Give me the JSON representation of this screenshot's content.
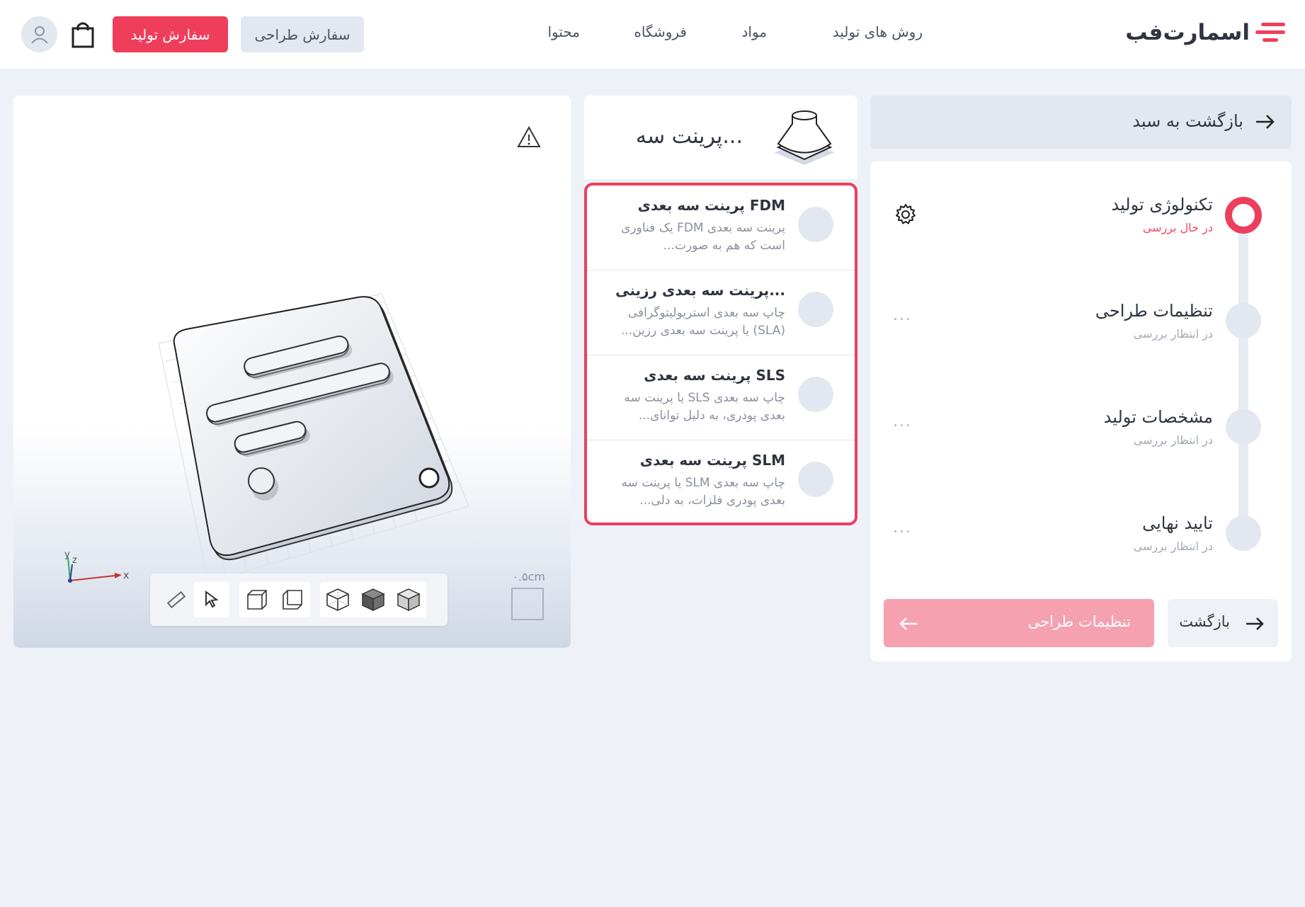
{
  "header": {
    "logo_text": "اسمارت‌فب",
    "nav": [
      {
        "label": "روش های تولید"
      },
      {
        "label": "مواد"
      },
      {
        "label": "فروشگاه"
      },
      {
        "label": "محتوا"
      }
    ],
    "design_order_label": "سفارش طراحی",
    "production_order_label": "سفارش تولید"
  },
  "viewer": {
    "scale_label": "۰.۵cm",
    "axis_x": "x",
    "axis_y": "y",
    "axis_z": "z"
  },
  "technology": {
    "header_title": "پرینت سه...",
    "items": [
      {
        "title": "پرینت سه بعدی FDM",
        "desc": "پرینت سه بعدی FDM یک فناوری است که هم به صورت..."
      },
      {
        "title": "پرینت سه بعدی رزینی...",
        "desc": "چاپ سه بعدی استریولیتوگرافی (SLA) یا پرینت سه بعدی رزین..."
      },
      {
        "title": "پرینت سه بعدی SLS",
        "desc": "چاپ سه بعدی SLS یا پرینت سه بعدی پودری، به دلیل توانای..."
      },
      {
        "title": "پرینت سه بعدی SLM",
        "desc": "چاپ سه بعدی SLM یا پرینت سه بعدی پودری فلزات، به دلی..."
      }
    ]
  },
  "steps": {
    "back_to_cart": "بازگشت به سبد",
    "items": [
      {
        "title": "تکنولوژی تولید",
        "status": "در حال بررسی"
      },
      {
        "title": "تنظیمات طراحی",
        "status": "در انتظار بررسی"
      },
      {
        "title": "مشخصات تولید",
        "status": "در انتظار بررسی"
      },
      {
        "title": "تایید نهایی",
        "status": "در انتظار بررسی"
      }
    ],
    "dots": "...",
    "next_label": "تنظیمات طراحی",
    "back_label": "بازگشت"
  },
  "colors": {
    "accent": "#ec3f5e",
    "accent_light": "#f5a1b0",
    "background": "#eef2f8"
  },
  "icons": [
    "logo-icon",
    "cart-icon",
    "user-icon",
    "warning-icon",
    "ruler-icon",
    "cursor-icon",
    "cube-icons",
    "gear-icon",
    "arrow-icon"
  ]
}
